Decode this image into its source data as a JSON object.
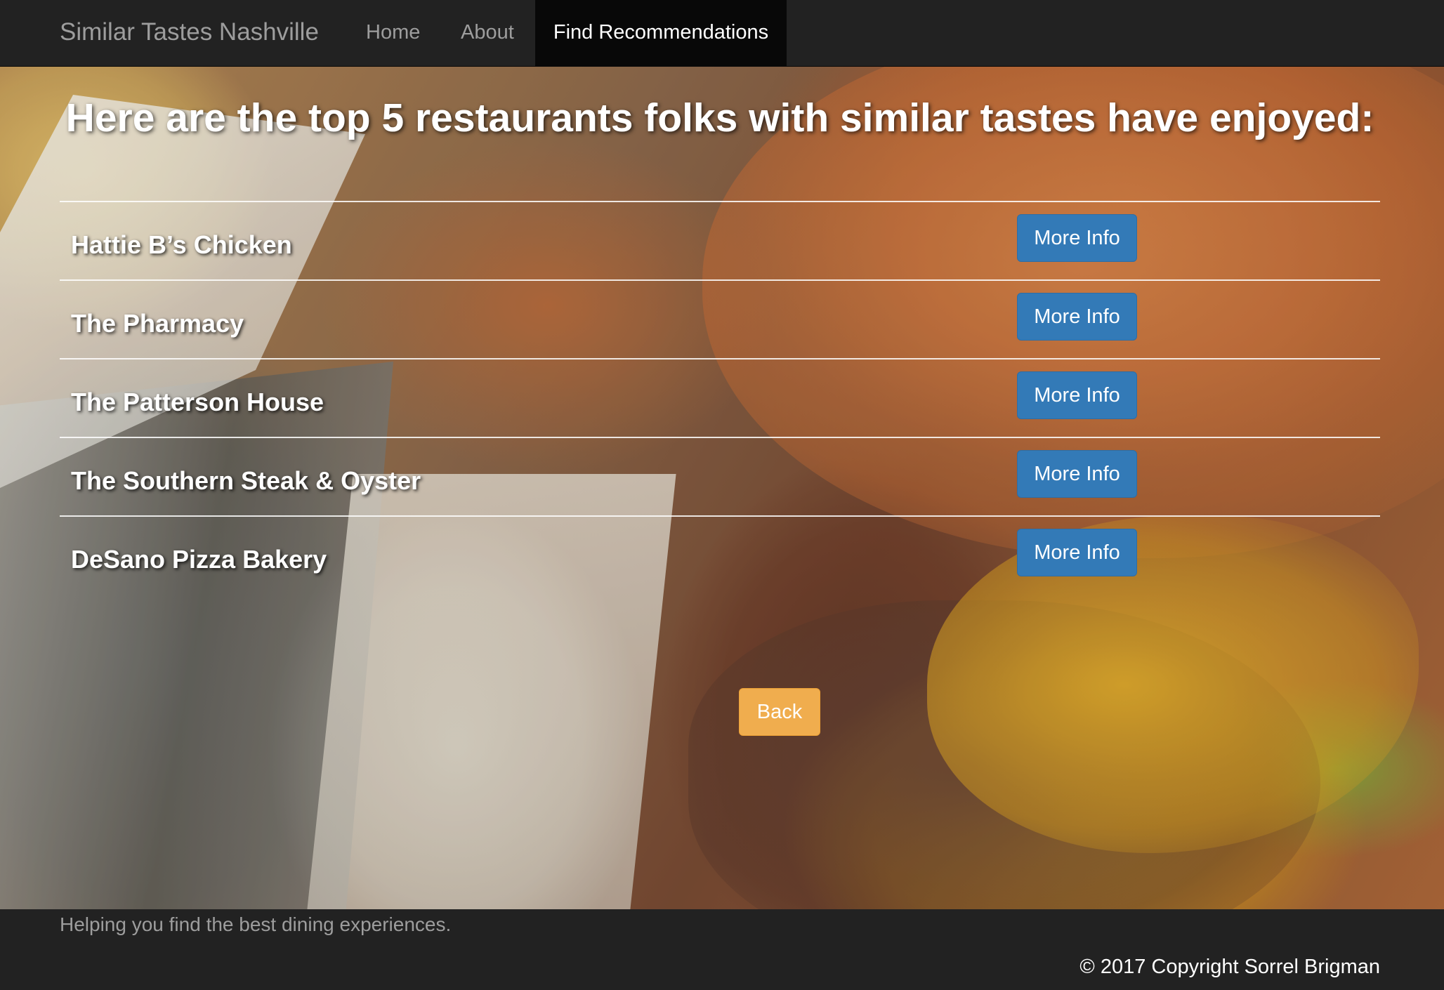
{
  "navbar": {
    "brand": "Similar Tastes Nashville",
    "items": [
      {
        "label": "Home"
      },
      {
        "label": "About"
      },
      {
        "label": "Find Recommendations",
        "active": true
      }
    ]
  },
  "main": {
    "heading": "Here are the top 5 restaurants folks with similar tastes have enjoyed:",
    "restaurants": [
      {
        "name": "Hattie B’s Chicken",
        "button": "More Info"
      },
      {
        "name": "The Pharmacy",
        "button": "More Info"
      },
      {
        "name": "The Patterson House",
        "button": "More Info"
      },
      {
        "name": "The Southern Steak & Oyster",
        "button": "More Info"
      },
      {
        "name": "DeSano Pizza Bakery",
        "button": "More Info"
      }
    ],
    "back_label": "Back"
  },
  "footer": {
    "tagline": "Helping you find the best dining experiences.",
    "copyright": "© 2017 Copyright Sorrel Brigman"
  },
  "colors": {
    "navbar_bg": "#222222",
    "nav_active_bg": "#080808",
    "primary_button": "#337ab7",
    "warning_button": "#f0ad4e"
  }
}
